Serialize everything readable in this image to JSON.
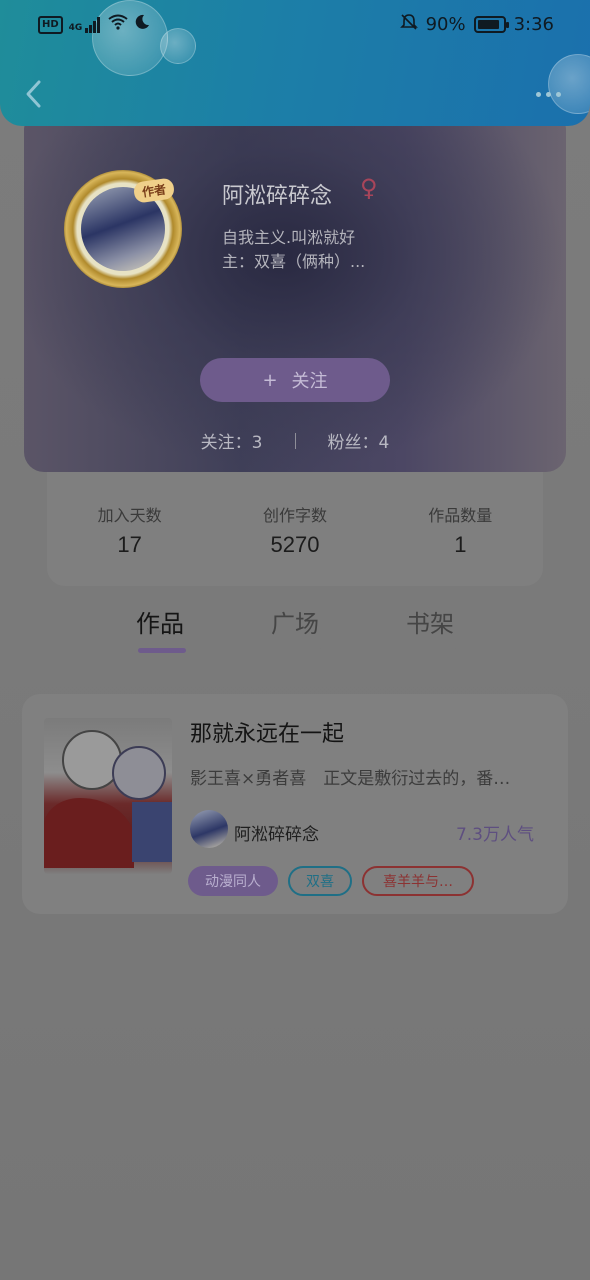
{
  "status_bar": {
    "network_badge": "HD",
    "network_type": "4G",
    "battery_percent": "90%",
    "battery_level": 0.9,
    "time": "3:36"
  },
  "header": {
    "back_icon": "chevron-left-icon",
    "more_icon": "more-horizontal-icon"
  },
  "profile": {
    "avatar_badge": "作者",
    "username": "阿淞碎碎念",
    "gender_symbol": "♀",
    "bio_line1": "自我主义.叫淞就好",
    "bio_line2": "主：双喜（俩种）...",
    "follow_plus": "+",
    "follow_label": "关注",
    "following": "关注：3",
    "followers": "粉丝：4"
  },
  "stats": [
    {
      "label": "加入天数",
      "value": "17"
    },
    {
      "label": "创作字数",
      "value": "5270"
    },
    {
      "label": "作品数量",
      "value": "1"
    }
  ],
  "tabs": [
    {
      "label": "作品",
      "active": true
    },
    {
      "label": "广场",
      "active": false
    },
    {
      "label": "书架",
      "active": false
    }
  ],
  "work": {
    "title": "那就永远在一起",
    "description": "影王喜×勇者喜　正文是敷衍过去的，番…",
    "author": "阿淞碎碎念",
    "popularity": "7.3万人气",
    "tags": [
      "动漫同人",
      "双喜",
      "喜羊羊与…"
    ]
  },
  "colors": {
    "header_teal": "#1c7fa7",
    "accent_purple": "#6e5b8c",
    "overlay_gray": "#777777"
  }
}
